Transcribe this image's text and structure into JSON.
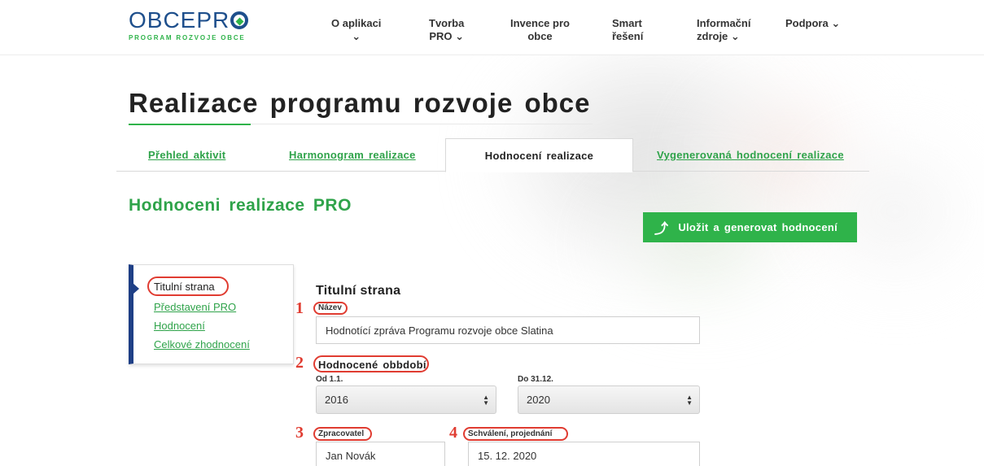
{
  "logo": {
    "main_prefix": "OBCEPR",
    "subtitle": "PROGRAM ROZVOJE OBCE"
  },
  "nav": [
    {
      "line1": "O aplikaci",
      "line2": "⌄"
    },
    {
      "line1": "Tvorba",
      "line2": "PRO ⌄"
    },
    {
      "line1": "Invence pro",
      "line2": "obce"
    },
    {
      "line1": "Smart",
      "line2": "řešení"
    },
    {
      "line1": "Informační",
      "line2": "zdroje ⌄"
    },
    {
      "line1": "Podpora ⌄",
      "line2": ""
    }
  ],
  "page_title": "Realizace programu rozvoje obce",
  "tabs": [
    {
      "label": "Přehled aktivit"
    },
    {
      "label": "Harmonogram realizace"
    },
    {
      "label": "Hodnocení realizace"
    },
    {
      "label": "Vygenerovaná hodnocení realizace"
    }
  ],
  "section_title": "Hodnoceni realizace PRO",
  "generate_button": {
    "icon": "merge-arrow-icon",
    "label": "Uložit a generovat hodnocení"
  },
  "sidenav": {
    "items": [
      {
        "label": "Titulní strana"
      },
      {
        "label": "Představení PRO"
      },
      {
        "label": "Hodnocení"
      },
      {
        "label": "Celkové zhodnocení"
      }
    ]
  },
  "form": {
    "title": "Titulní strana",
    "name_label": "Název",
    "name_value": "Hodnotící zpráva Programu rozvoje obce Slatina",
    "period_label": "Hodnocené obbdobí",
    "from_label": "Od 1.1.",
    "from_value": "2016",
    "to_label": "Do 31.12.",
    "to_value": "2020",
    "processor_label": "Zpracovatel",
    "processor_value": "Jan Novák",
    "approval_label": "Schválení, projednání",
    "approval_value": "15. 12. 2020"
  },
  "annotations": {
    "n1": "1",
    "n2": "2",
    "n3": "3",
    "n4": "4"
  },
  "colors": {
    "accent_green": "#2fb34a",
    "brand_blue": "#1e4f8c",
    "annotation_red": "#e03c31"
  }
}
